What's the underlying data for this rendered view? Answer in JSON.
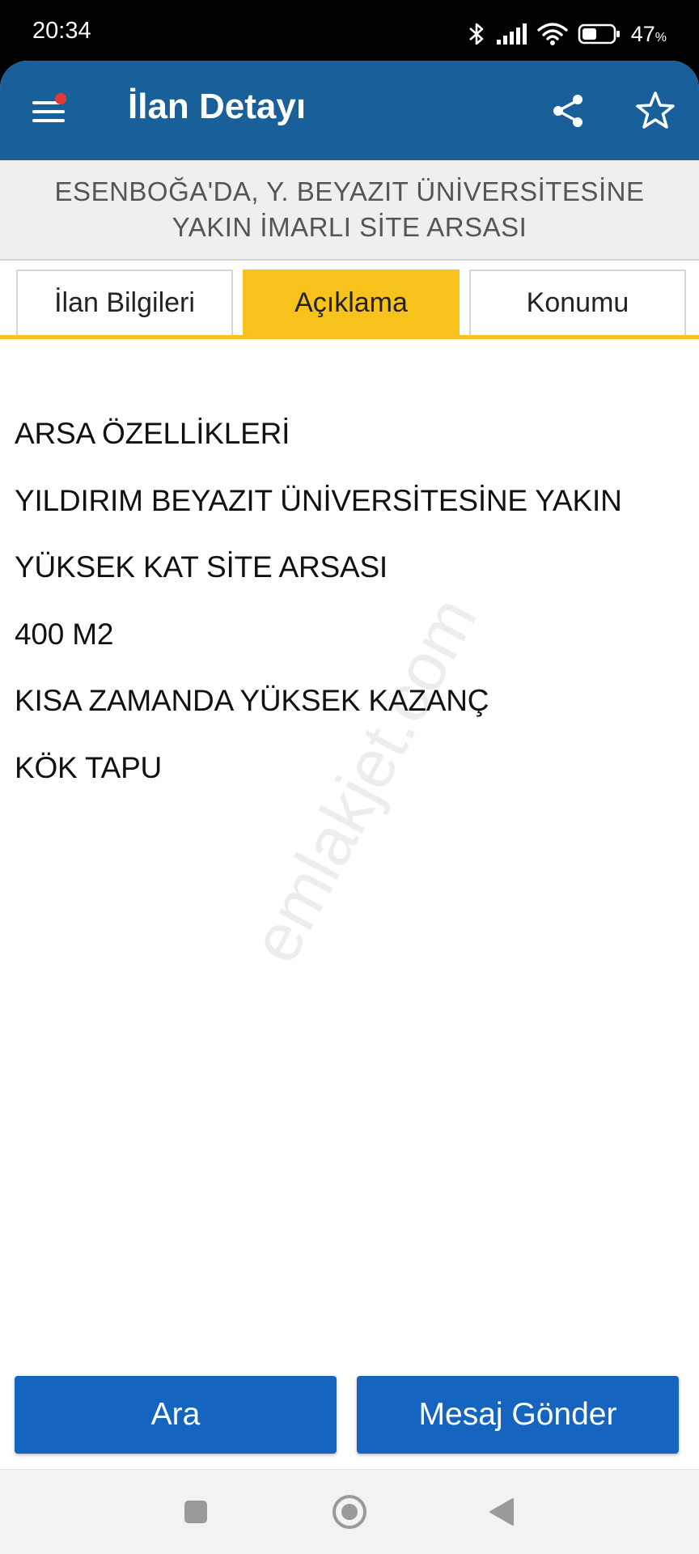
{
  "status_bar": {
    "time": "20:34",
    "battery_percent": "47",
    "battery_unit": "%",
    "battery_level": 0.47,
    "icons": [
      "bluetooth-icon",
      "signal-icon",
      "wifi-icon",
      "battery-icon"
    ]
  },
  "app_bar": {
    "title": "İlan Detayı",
    "icons": [
      "menu-icon",
      "share-icon",
      "star-icon"
    ],
    "has_notification_dot": true
  },
  "listing": {
    "title_line1": "ESENBOĞA'DA, Y. BEYAZIT ÜNİVERSİTESİNE",
    "title_line2": "YAKIN İMARLI SİTE ARSASI"
  },
  "tabs": [
    {
      "label": "İlan Bilgileri",
      "active": false
    },
    {
      "label": "Açıklama",
      "active": true
    },
    {
      "label": "Konumu",
      "active": false
    }
  ],
  "description": {
    "lines": [
      "ARSA ÖZELLİKLERİ",
      "YILDIRIM BEYAZIT ÜNİVERSİTESİNE YAKIN",
      "YÜKSEK KAT SİTE ARSASI",
      "400 M2",
      "KISA ZAMANDA YÜKSEK KAZANÇ",
      "KÖK TAPU"
    ]
  },
  "watermark": "emlakjet.com",
  "actions": {
    "call_label": "Ara",
    "message_label": "Mesaj Gönder"
  },
  "nav_bar": {
    "icons": [
      "recents-icon",
      "home-icon",
      "back-icon"
    ]
  },
  "colors": {
    "app_bar": "#195f9a",
    "accent_tab": "#f7c21c",
    "action_button": "#1565c0",
    "notification_dot": "#e53935"
  }
}
